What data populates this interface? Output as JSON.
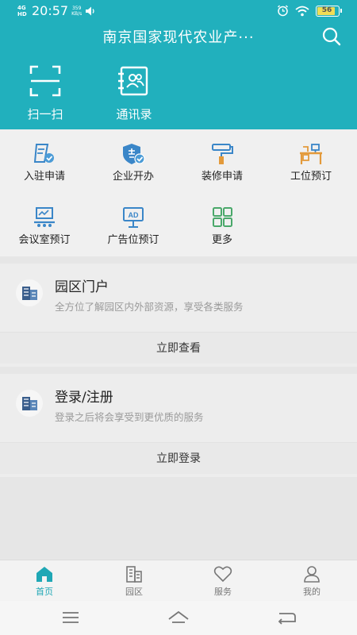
{
  "status_bar": {
    "network": "4G HD",
    "time": "20:57",
    "speed": "359",
    "speed_unit": "KB/s",
    "battery": "56",
    "icons": [
      "volume-icon",
      "alarm-icon",
      "wifi-icon",
      "battery-icon"
    ]
  },
  "header": {
    "title": "南京国家现代农业产···",
    "search_icon": "search-icon"
  },
  "quick_actions": [
    {
      "label": "扫一扫",
      "icon": "scan-icon"
    },
    {
      "label": "通讯录",
      "icon": "contacts-icon"
    }
  ],
  "services": [
    {
      "label": "入驻申请",
      "icon": "application-icon"
    },
    {
      "label": "企业开办",
      "icon": "enterprise-icon"
    },
    {
      "label": "装修申请",
      "icon": "paint-roller-icon"
    },
    {
      "label": "工位预订",
      "icon": "desk-icon"
    },
    {
      "label": "会议室预订",
      "icon": "meeting-room-icon"
    },
    {
      "label": "广告位预订",
      "icon": "ad-icon"
    },
    {
      "label": "更多",
      "icon": "grid-icon"
    }
  ],
  "cards": [
    {
      "title": "园区门户",
      "desc": "全方位了解园区内外部资源，享受各类服务",
      "action": "立即查看",
      "icon": "building-icon"
    },
    {
      "title": "登录/注册",
      "desc": "登录之后将会享受到更优质的服务",
      "action": "立即登录",
      "icon": "building-icon"
    }
  ],
  "tabs": [
    {
      "label": "首页",
      "icon": "home-icon",
      "active": true
    },
    {
      "label": "园区",
      "icon": "park-icon",
      "active": false
    },
    {
      "label": "服务",
      "icon": "heart-icon",
      "active": false
    },
    {
      "label": "我的",
      "icon": "user-icon",
      "active": false
    }
  ],
  "colors": {
    "primary": "#21b0bd",
    "active_tab": "#1fa7b5",
    "icon_blue": "#3a86c8",
    "icon_orange": "#e39a3b",
    "icon_green": "#4aa86a"
  }
}
